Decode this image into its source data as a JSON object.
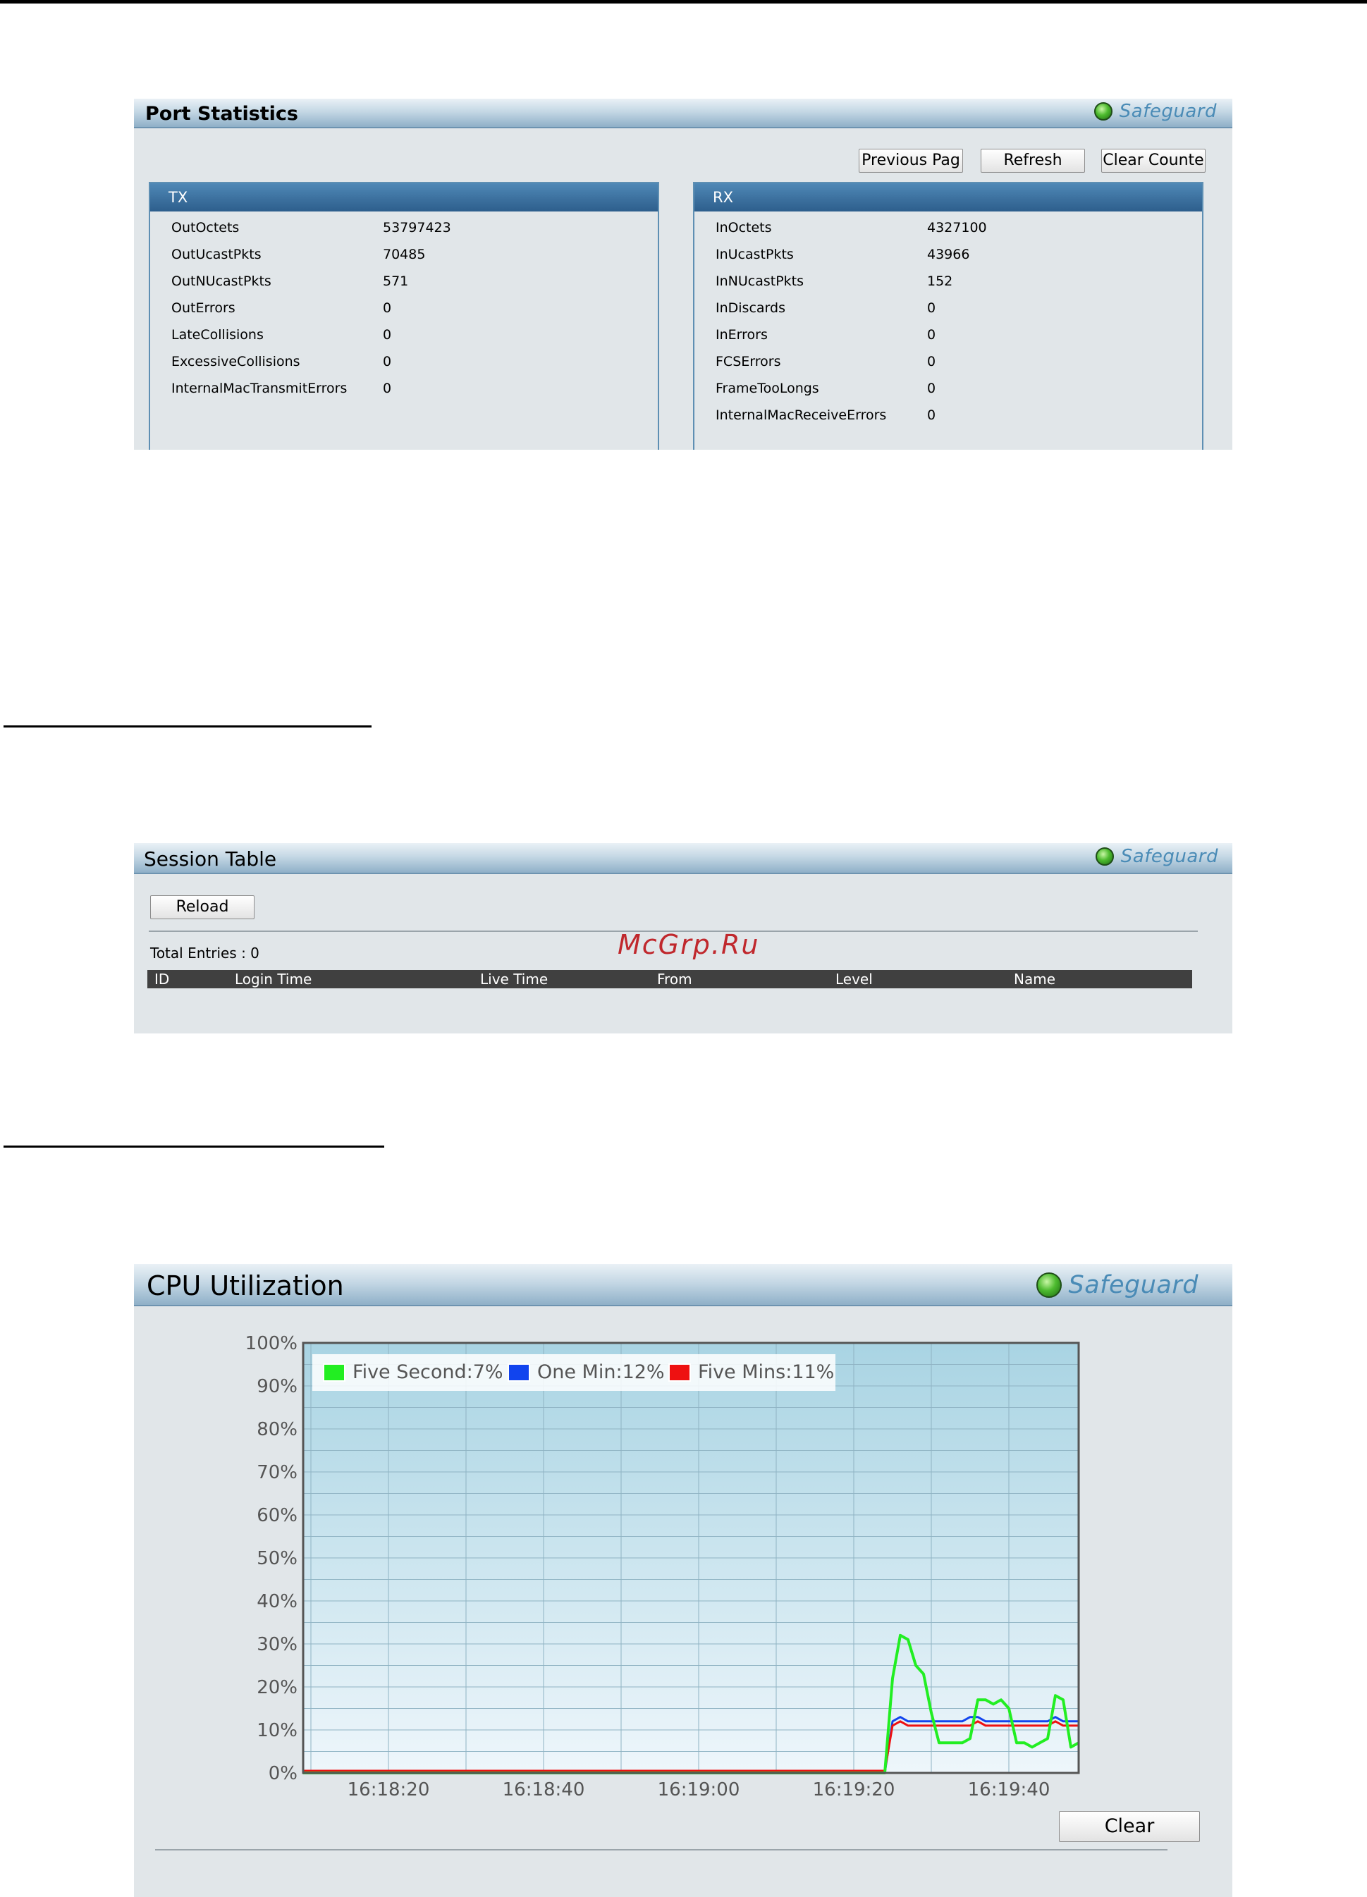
{
  "port_statistics": {
    "title": "Port Statistics",
    "safeguard": "Safeguard",
    "buttons": {
      "previous": "Previous Pag",
      "refresh": "Refresh",
      "clear": "Clear Counte"
    },
    "tx": {
      "header": "TX",
      "rows": [
        {
          "name": "OutOctets",
          "value": "53797423"
        },
        {
          "name": "OutUcastPkts",
          "value": "70485"
        },
        {
          "name": "OutNUcastPkts",
          "value": "571"
        },
        {
          "name": "OutErrors",
          "value": "0"
        },
        {
          "name": "LateCollisions",
          "value": "0"
        },
        {
          "name": "ExcessiveCollisions",
          "value": "0"
        },
        {
          "name": "InternalMacTransmitErrors",
          "value": "0"
        }
      ]
    },
    "rx": {
      "header": "RX",
      "rows": [
        {
          "name": "InOctets",
          "value": "4327100"
        },
        {
          "name": "InUcastPkts",
          "value": "43966"
        },
        {
          "name": "InNUcastPkts",
          "value": "152"
        },
        {
          "name": "InDiscards",
          "value": "0"
        },
        {
          "name": "InErrors",
          "value": "0"
        },
        {
          "name": "FCSErrors",
          "value": "0"
        },
        {
          "name": "FrameTooLongs",
          "value": "0"
        },
        {
          "name": "InternalMacReceiveErrors",
          "value": "0"
        }
      ]
    }
  },
  "session_table": {
    "title": "Session Table",
    "safeguard": "Safeguard",
    "reload_label": "Reload",
    "total_entries": "Total Entries : 0",
    "columns": [
      "ID",
      "Login Time",
      "Live Time",
      "From",
      "Level",
      "Name"
    ]
  },
  "watermark": "McGrp.Ru",
  "cpu_utilization": {
    "title": "CPU Utilization",
    "safeguard": "Safeguard",
    "clear_label": "Clear"
  },
  "colors": {
    "five_second": "#22ee22",
    "one_min": "#1144ee",
    "five_mins": "#ee1111",
    "plot_bg_top": "#a9d4e3",
    "plot_bg_bottom": "#eef6fb"
  },
  "chart_data": {
    "type": "line",
    "title": "",
    "xlabel": "",
    "ylabel": "",
    "ylim": [
      0,
      100
    ],
    "y_ticks": [
      "0%",
      "10%",
      "20%",
      "30%",
      "40%",
      "50%",
      "60%",
      "70%",
      "80%",
      "90%",
      "100%"
    ],
    "x_ticks": [
      "16:18:20",
      "16:18:40",
      "16:19:00",
      "16:19:20",
      "16:19:40"
    ],
    "x": [
      "16:18:09",
      "16:18:11",
      "16:18:13",
      "16:18:15",
      "16:18:17",
      "16:18:19",
      "16:18:21",
      "16:18:23",
      "16:18:25",
      "16:18:27",
      "16:18:29",
      "16:18:31",
      "16:18:33",
      "16:18:35",
      "16:18:37",
      "16:18:39",
      "16:18:41",
      "16:18:43",
      "16:18:45",
      "16:18:47",
      "16:18:49",
      "16:18:51",
      "16:18:53",
      "16:18:55",
      "16:18:57",
      "16:18:59",
      "16:19:01",
      "16:19:03",
      "16:19:05",
      "16:19:07",
      "16:19:09",
      "16:19:11",
      "16:19:13",
      "16:19:15",
      "16:19:17",
      "16:19:19",
      "16:19:21",
      "16:19:23",
      "16:19:24",
      "16:19:25",
      "16:19:26",
      "16:19:27",
      "16:19:28",
      "16:19:29",
      "16:19:30",
      "16:19:31",
      "16:19:32",
      "16:19:33",
      "16:19:34",
      "16:19:35",
      "16:19:36",
      "16:19:37",
      "16:19:38",
      "16:19:39",
      "16:19:40",
      "16:19:41",
      "16:19:42",
      "16:19:43",
      "16:19:44",
      "16:19:45",
      "16:19:46",
      "16:19:47",
      "16:19:48",
      "16:19:49"
    ],
    "series": [
      {
        "name": "Five Second:7%",
        "color": "#22ee22",
        "values": [
          0,
          0,
          0,
          0,
          0,
          0,
          0,
          0,
          0,
          0,
          0,
          0,
          0,
          0,
          0,
          0,
          0,
          0,
          0,
          0,
          0,
          0,
          0,
          0,
          0,
          0,
          0,
          0,
          0,
          0,
          0,
          0,
          0,
          0,
          0,
          0,
          0,
          0,
          0,
          22,
          32,
          31,
          25,
          23,
          14,
          7,
          7,
          7,
          7,
          8,
          17,
          17,
          16,
          17,
          15,
          7,
          7,
          6,
          7,
          8,
          18,
          17,
          6,
          7
        ]
      },
      {
        "name": "One Min:12%",
        "color": "#1144ee",
        "values": [
          0,
          0,
          0,
          0,
          0,
          0,
          0,
          0,
          0,
          0,
          0,
          0,
          0,
          0,
          0,
          0,
          0,
          0,
          0,
          0,
          0,
          0,
          0,
          0,
          0,
          0,
          0,
          0,
          0,
          0,
          0,
          0,
          0,
          0,
          0,
          0,
          0,
          0,
          0,
          12,
          13,
          12,
          12,
          12,
          12,
          12,
          12,
          12,
          12,
          13,
          13,
          12,
          12,
          12,
          12,
          12,
          12,
          12,
          12,
          12,
          13,
          12,
          12,
          12
        ]
      },
      {
        "name": "Five Mins:11%",
        "color": "#ee1111",
        "values": [
          0.5,
          0.5,
          0.5,
          0.5,
          0.5,
          0.5,
          0.5,
          0.5,
          0.5,
          0.5,
          0.5,
          0.5,
          0.5,
          0.5,
          0.5,
          0.5,
          0.5,
          0.5,
          0.5,
          0.5,
          0.5,
          0.5,
          0.5,
          0.5,
          0.5,
          0.5,
          0.5,
          0.5,
          0.5,
          0.5,
          0.5,
          0.5,
          0.5,
          0.5,
          0.5,
          0.5,
          0.5,
          0.5,
          0.5,
          11,
          12,
          11,
          11,
          11,
          11,
          11,
          11,
          11,
          11,
          11,
          12,
          11,
          11,
          11,
          11,
          11,
          11,
          11,
          11,
          11,
          12,
          11,
          11,
          11
        ]
      }
    ]
  }
}
